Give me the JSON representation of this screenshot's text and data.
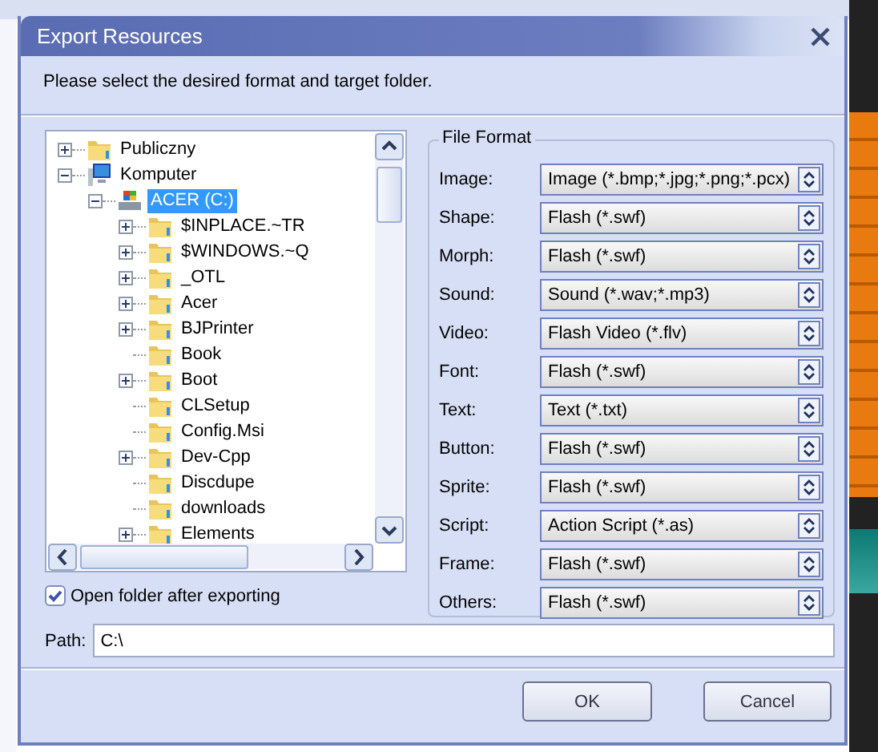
{
  "window": {
    "title": "Export Resources"
  },
  "instruction": "Please select the desired format and target folder.",
  "tree": [
    {
      "label": "Publiczny",
      "kind": "folder",
      "has_children": true,
      "expanded": false,
      "selected": false
    },
    {
      "label": "Komputer",
      "kind": "computer",
      "has_children": true,
      "expanded": true,
      "selected": false,
      "children": [
        {
          "label": "ACER (C:)",
          "kind": "drive",
          "has_children": true,
          "expanded": true,
          "selected": true,
          "children": [
            {
              "label": "$INPLACE.~TR",
              "kind": "folder",
              "has_children": true,
              "expanded": false,
              "selected": false
            },
            {
              "label": "$WINDOWS.~Q",
              "kind": "folder",
              "has_children": true,
              "expanded": false,
              "selected": false
            },
            {
              "label": "_OTL",
              "kind": "folder",
              "has_children": true,
              "expanded": false,
              "selected": false
            },
            {
              "label": "Acer",
              "kind": "folder",
              "has_children": true,
              "expanded": false,
              "selected": false
            },
            {
              "label": "BJPrinter",
              "kind": "folder",
              "has_children": true,
              "expanded": false,
              "selected": false
            },
            {
              "label": "Book",
              "kind": "folder",
              "has_children": false,
              "selected": false
            },
            {
              "label": "Boot",
              "kind": "folder",
              "has_children": true,
              "expanded": false,
              "selected": false
            },
            {
              "label": "CLSetup",
              "kind": "folder",
              "has_children": false,
              "selected": false
            },
            {
              "label": "Config.Msi",
              "kind": "folder",
              "has_children": false,
              "selected": false
            },
            {
              "label": "Dev-Cpp",
              "kind": "folder",
              "has_children": true,
              "expanded": false,
              "selected": false
            },
            {
              "label": "Discdupe",
              "kind": "folder",
              "has_children": false,
              "selected": false
            },
            {
              "label": "downloads",
              "kind": "folder",
              "has_children": false,
              "selected": false
            },
            {
              "label": "Elements",
              "kind": "folder",
              "has_children": true,
              "expanded": false,
              "selected": false
            }
          ]
        }
      ]
    }
  ],
  "file_format": {
    "title": "File Format",
    "rows": [
      {
        "label": "Image:",
        "value": "Image (*.bmp;*.jpg;*.png;*.pcx)"
      },
      {
        "label": "Shape:",
        "value": "Flash (*.swf)"
      },
      {
        "label": "Morph:",
        "value": "Flash (*.swf)"
      },
      {
        "label": "Sound:",
        "value": "Sound (*.wav;*.mp3)"
      },
      {
        "label": "Video:",
        "value": "Flash Video (*.flv)"
      },
      {
        "label": "Font:",
        "value": "Flash (*.swf)"
      },
      {
        "label": "Text:",
        "value": "Text (*.txt)"
      },
      {
        "label": "Button:",
        "value": "Flash (*.swf)"
      },
      {
        "label": "Sprite:",
        "value": "Flash (*.swf)"
      },
      {
        "label": "Script:",
        "value": "Action Script (*.as)"
      },
      {
        "label": "Frame:",
        "value": "Flash (*.swf)"
      },
      {
        "label": "Others:",
        "value": "Flash (*.swf)"
      }
    ]
  },
  "open_folder": {
    "label": "Open folder after exporting",
    "checked": true
  },
  "path": {
    "label": "Path:",
    "value": "C:\\"
  },
  "buttons": [
    "OK",
    "Cancel"
  ]
}
